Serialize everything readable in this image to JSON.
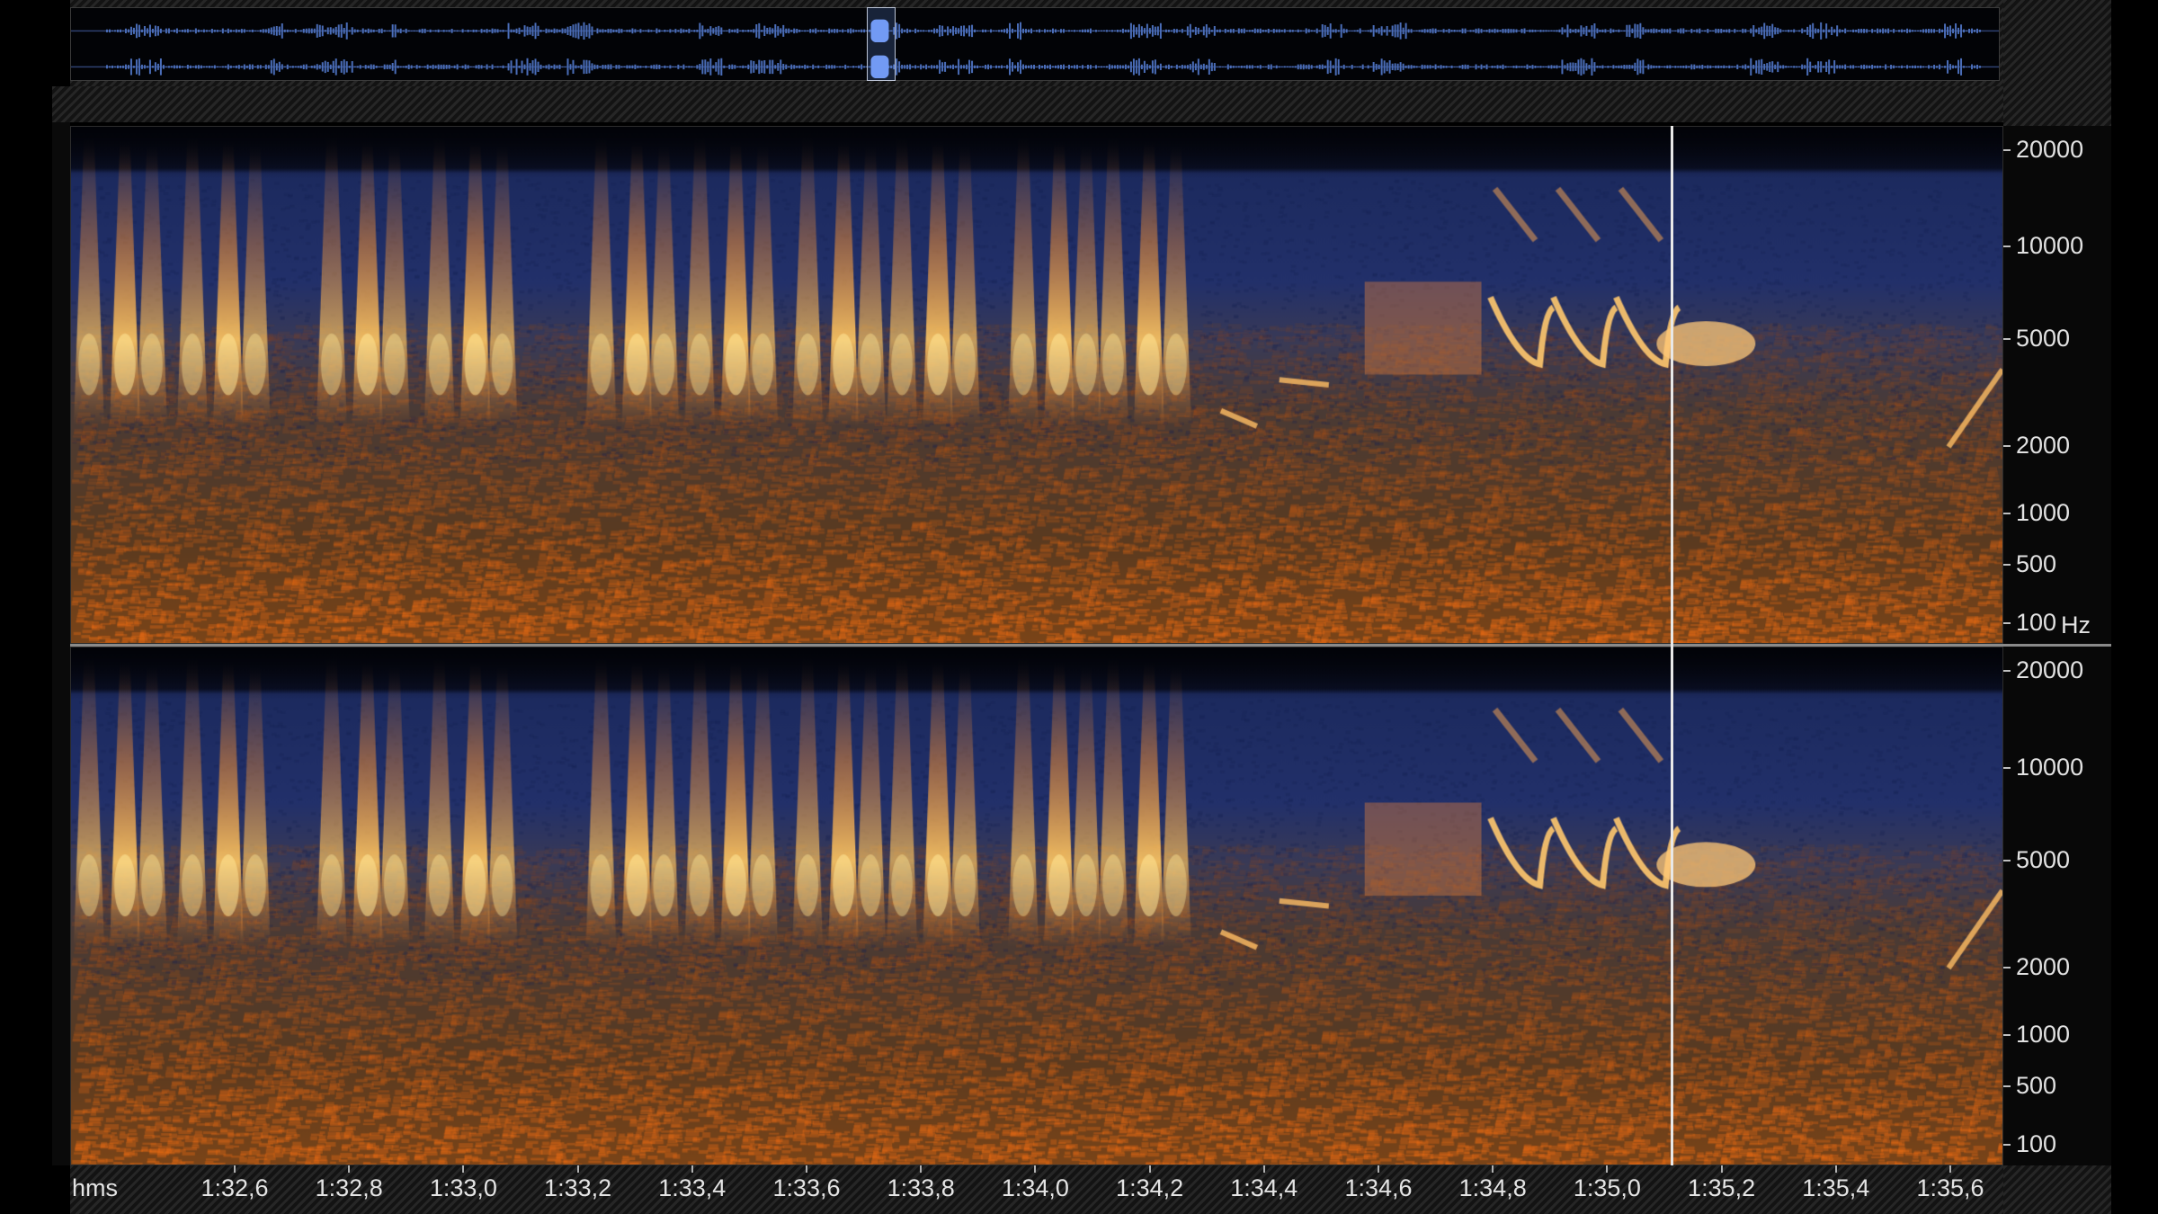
{
  "overview": {
    "label": "",
    "waveform_color": "#4a6db8",
    "selection_color": "#7aa2ff",
    "selection_position": 0.413
  },
  "spectrogram": {
    "channels": [
      {
        "name": "",
        "frequency_labels": [
          "20000",
          "10000",
          "5000",
          "2000",
          "1000",
          "500",
          "100"
        ]
      },
      {
        "name": "",
        "frequency_labels": [
          "20000",
          "10000",
          "5000",
          "2000",
          "1000",
          "500",
          "100"
        ]
      }
    ],
    "frequency_unit": "Hz",
    "colormap": {
      "low": "#0a1230",
      "mid": "#22306a",
      "high": "#ff9a30",
      "peak": "#ffe08a"
    }
  },
  "time_ruler": {
    "unit": "hms",
    "labels": [
      "1:32,6",
      "1:32,8",
      "1:33,0",
      "1:33,2",
      "1:33,4",
      "1:33,6",
      "1:33,8",
      "1:34,0",
      "1:34,2",
      "1:34,4",
      "1:34,6",
      "1:34,8",
      "1:35,0",
      "1:35,2",
      "1:35,4",
      "1:35,6"
    ]
  },
  "playhead": {
    "time": "1:35,12"
  }
}
